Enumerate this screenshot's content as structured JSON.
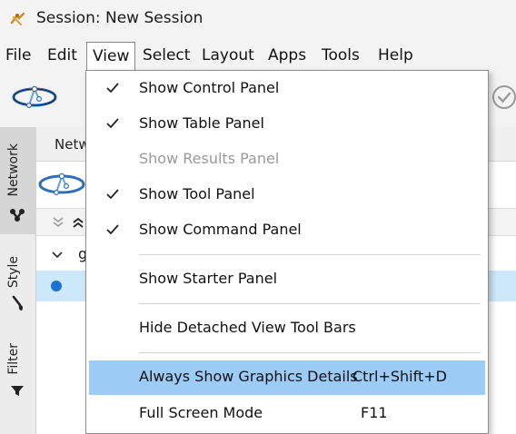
{
  "window": {
    "title": "Session: New Session"
  },
  "menubar": {
    "items": [
      {
        "label": "File"
      },
      {
        "label": "Edit"
      },
      {
        "label": "View"
      },
      {
        "label": "Select"
      },
      {
        "label": "Layout"
      },
      {
        "label": "Apps"
      },
      {
        "label": "Tools"
      },
      {
        "label": "Help"
      }
    ]
  },
  "side_tabs": [
    {
      "label": "Network",
      "icon": "network-icon",
      "active": true
    },
    {
      "label": "Style",
      "icon": "paintbrush-icon",
      "active": false
    },
    {
      "label": "Filter",
      "icon": "filter-icon",
      "active": false
    }
  ],
  "network_panel": {
    "header_label": "Netw",
    "tree_partial_text": "g"
  },
  "view_menu": {
    "items": [
      {
        "label": "Show Control Panel",
        "checked": true,
        "enabled": true,
        "shortcut": ""
      },
      {
        "label": "Show Table Panel",
        "checked": true,
        "enabled": true,
        "shortcut": ""
      },
      {
        "label": "Show Results Panel",
        "checked": false,
        "enabled": false,
        "shortcut": ""
      },
      {
        "label": "Show Tool Panel",
        "checked": true,
        "enabled": true,
        "shortcut": ""
      },
      {
        "label": "Show Command Panel",
        "checked": true,
        "enabled": true,
        "shortcut": ""
      },
      {
        "label": "Show Starter Panel",
        "checked": false,
        "enabled": true,
        "shortcut": ""
      },
      {
        "label": "Hide Detached View Tool Bars",
        "checked": false,
        "enabled": true,
        "shortcut": ""
      },
      {
        "label": "Always Show Graphics Details",
        "checked": false,
        "enabled": true,
        "highlighted": true,
        "shortcut": "Ctrl+Shift+D"
      },
      {
        "label": "Full Screen Mode",
        "checked": false,
        "enabled": true,
        "shortcut": "F11"
      }
    ]
  },
  "colors": {
    "menu_highlight": "#9ccbf5",
    "selected_row": "#cde8fb",
    "dot": "#1e72d6",
    "disabled_text": "#9a9a9a"
  }
}
